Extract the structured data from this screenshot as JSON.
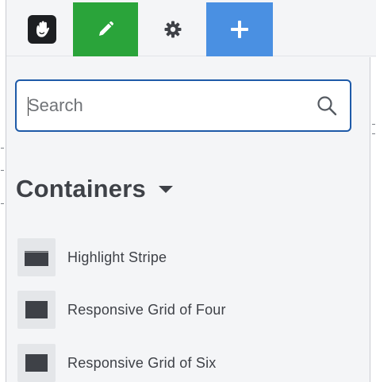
{
  "toolbar": {
    "logo_icon": "concrete-hand-logo-icon",
    "edit_icon": "pencil-icon",
    "settings_icon": "gear-icon",
    "add_icon": "plus-icon",
    "colors": {
      "edit_bg": "#2aa43a",
      "add_bg": "#4a90e2",
      "gear": "#3e4147"
    }
  },
  "search": {
    "placeholder": "Search",
    "value": "",
    "icon": "search-icon",
    "border_color": "#1e5aa8"
  },
  "section": {
    "title": "Containers",
    "toggle_icon": "caret-down-icon"
  },
  "items": [
    {
      "label": "Responsive Grid of Four"
    },
    {
      "label": "Responsive Grid of Six"
    }
  ],
  "highlight_stripe": {
    "label": "Highlight Stripe"
  }
}
